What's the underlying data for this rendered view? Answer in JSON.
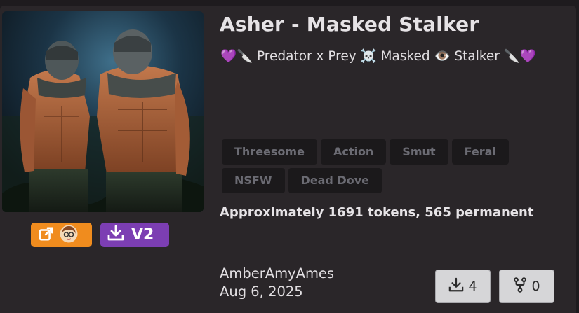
{
  "card": {
    "title": "Asher - Masked Stalker",
    "subtitle": "💜🔪 Predator x Prey ☠️ Masked 👁️ Stalker 🔪💜",
    "tags": [
      "Threesome",
      "Action",
      "Smut",
      "Feral",
      "NSFW",
      "Dead Dove"
    ],
    "tokens": "Approximately 1691 tokens, 565 permanent",
    "author": "AmberAmyAmes",
    "date": "Aug 6, 2025",
    "download_label": "V2",
    "downloads": "4",
    "forks": "0"
  },
  "icons": {
    "open": "external-link-icon",
    "avatar": "creator-avatar-icon",
    "download": "download-icon",
    "fork": "fork-icon"
  },
  "colors": {
    "open_button": "#f08c1e",
    "download_button": "#7c3eb3",
    "tag_bg": "#1b191b",
    "card_bg": "#2a2629"
  }
}
